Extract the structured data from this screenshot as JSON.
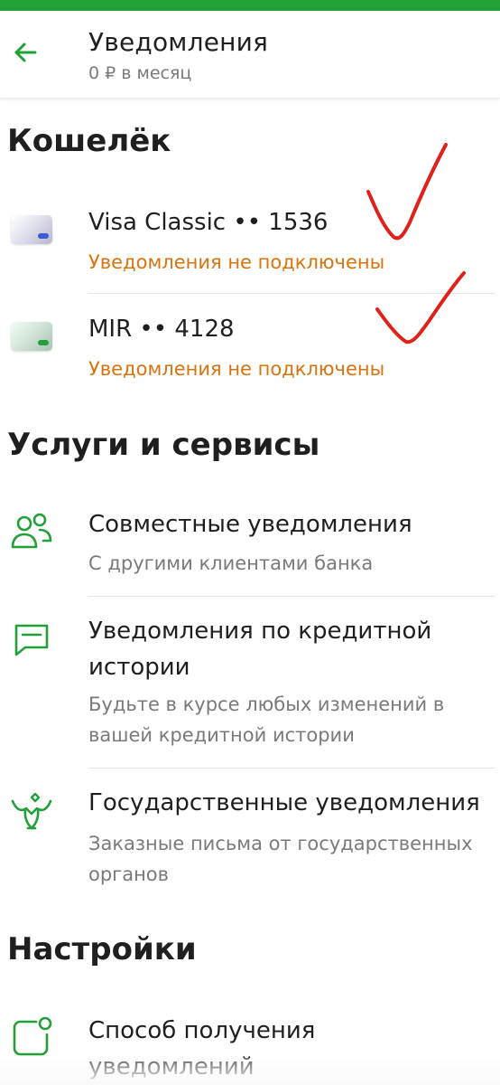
{
  "header": {
    "title": "Уведомления",
    "subtitle": "0 ₽ в месяц"
  },
  "wallet": {
    "title": "Кошелёк",
    "cards": [
      {
        "name": "Visa Classic •• 1536",
        "status": "Уведомления не подключены"
      },
      {
        "name": "MIR •• 4128",
        "status": "Уведомления не подключены"
      }
    ]
  },
  "services": {
    "title": "Услуги и сервисы",
    "items": [
      {
        "title": "Совместные уведомления",
        "subtitle": "С другими клиентами банка"
      },
      {
        "title": "Уведомления по кредитной истории",
        "subtitle": "Будьте в курсе любых изменений в вашей кредитной истории"
      },
      {
        "title": "Государственные уведомления",
        "subtitle": "Заказные письма от государственных органов"
      }
    ]
  },
  "settings": {
    "title": "Настройки",
    "items": [
      {
        "title": "Способ получения уведомлений"
      }
    ]
  },
  "colors": {
    "accent": "#21a038",
    "warning": "#d9730d",
    "annotation": "#e0201b"
  }
}
